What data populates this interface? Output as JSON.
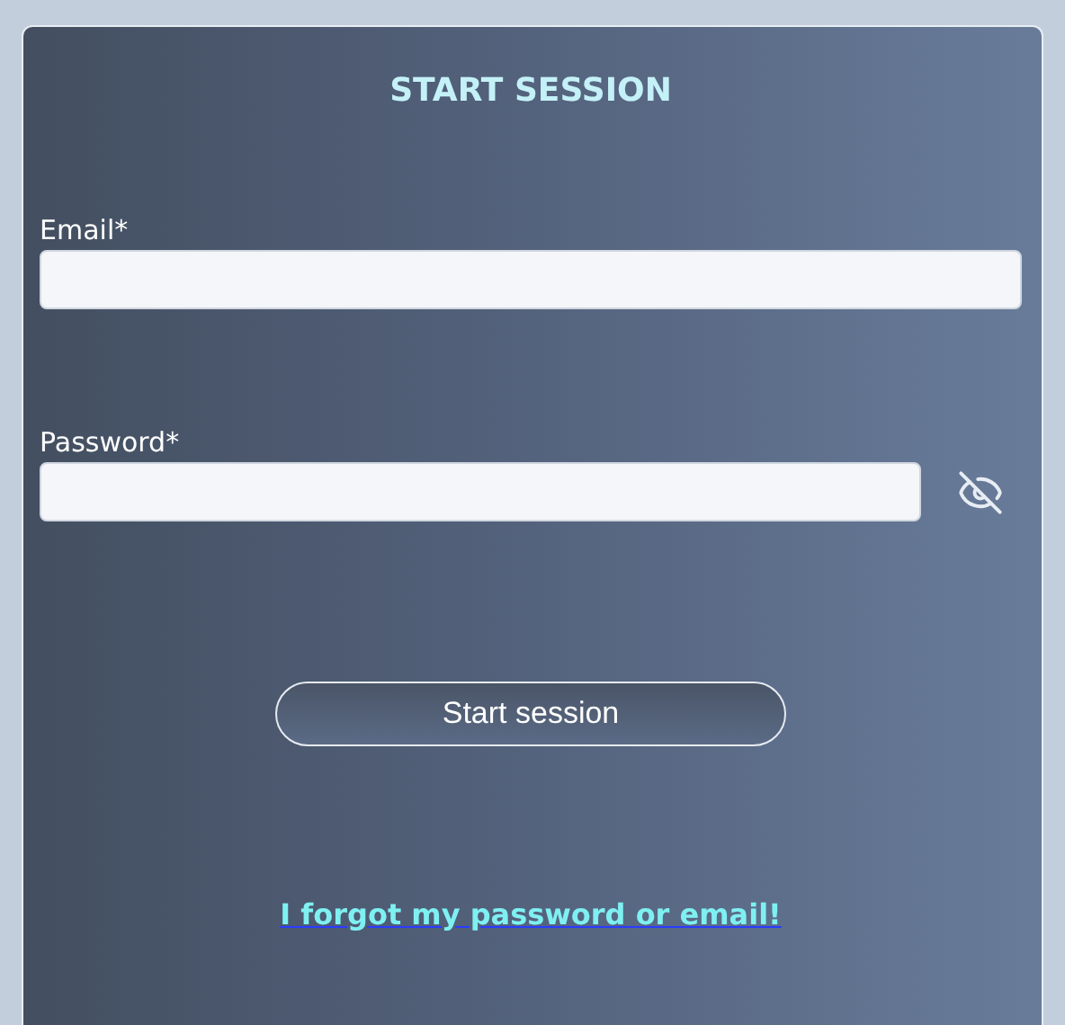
{
  "title": "START SESSION",
  "fields": [
    {
      "label": "Email*",
      "kind": "email"
    },
    {
      "label": "Password*",
      "kind": "password"
    }
  ],
  "submit": "Start session",
  "forgot_link": "I forgot my password or email!"
}
